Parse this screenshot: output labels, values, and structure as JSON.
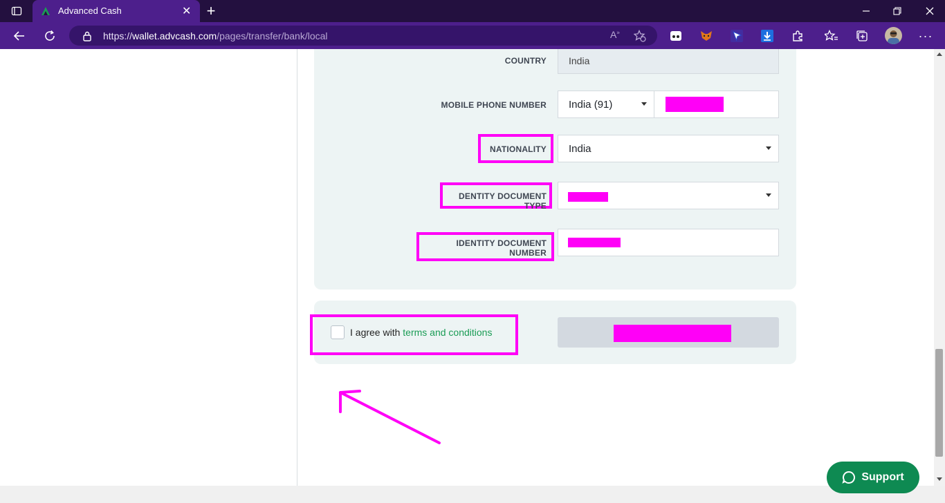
{
  "browser": {
    "tab_title": "Advanced Cash",
    "url_prefix": "https://",
    "url_host": "wallet.advcash.com",
    "url_path": "/pages/transfer/bank/local"
  },
  "form": {
    "country": {
      "label": "COUNTRY",
      "value": "India"
    },
    "mobile": {
      "label": "MOBILE PHONE NUMBER",
      "code": "India (91)"
    },
    "nationality": {
      "label": "NATIONALITY",
      "value": "India"
    },
    "doc_type": {
      "label": "DENTITY DOCUMENT TYPE"
    },
    "doc_number": {
      "label": "IDENTITY DOCUMENT NUMBER"
    }
  },
  "agreement": {
    "prefix": "I agree with ",
    "link": "terms and conditions"
  },
  "support": {
    "label": "Support"
  },
  "colors": {
    "browser_frame": "#4d1f8c",
    "annotation": "#ff00f7",
    "link": "#1a9c55",
    "support_bg": "#0e8a52"
  }
}
